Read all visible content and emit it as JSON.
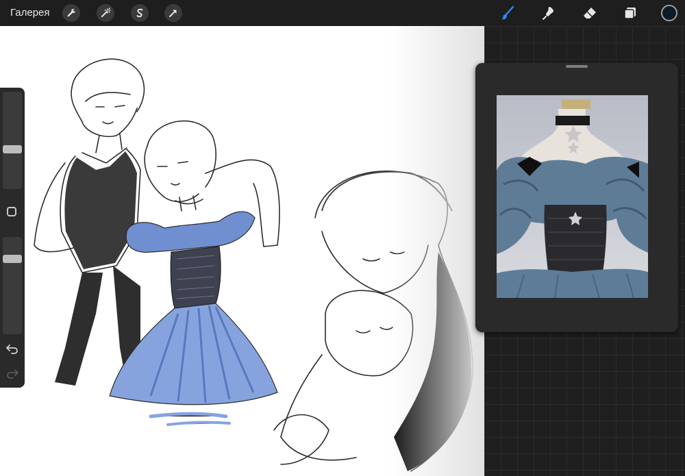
{
  "header": {
    "gallery_label": "Галерея"
  },
  "toolbar": {
    "left_tools": [
      "wrench-icon",
      "magic-wand-icon",
      "selection-s-icon",
      "transform-arrow-icon"
    ],
    "right_tools": [
      "brush-icon",
      "smudge-icon",
      "eraser-icon",
      "layers-icon"
    ],
    "active_tool": "brush-icon",
    "active_color": "#0d1b26",
    "accent": "#2f8cff"
  },
  "sidebar": {
    "brush_size": 0.4,
    "opacity": 0.8
  },
  "reference": {
    "visible": true
  },
  "colors": {
    "canvas": "#ffffff",
    "dress_blue": "#7f9ed8",
    "ref_fabric": "#5a7690"
  }
}
